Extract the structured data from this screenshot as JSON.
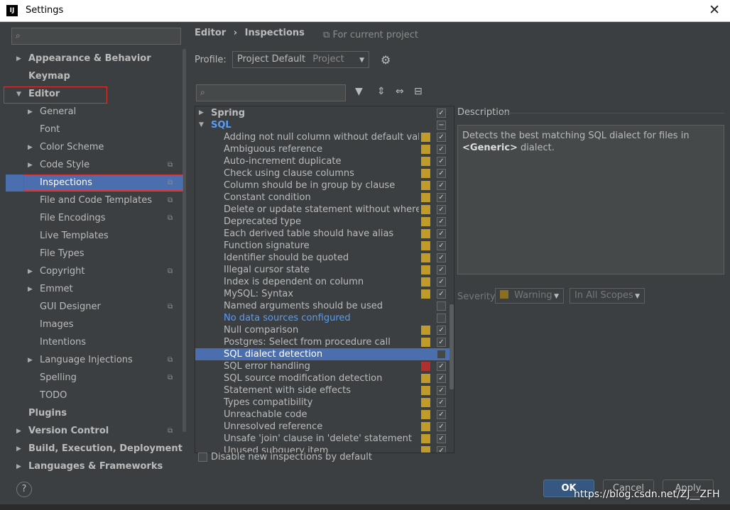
{
  "window": {
    "title": "Settings",
    "app_icon": "IJ",
    "close_symbol": "✕"
  },
  "sidebar": {
    "search_icon": "⌕",
    "items": [
      {
        "label": "Appearance & Behavior",
        "bold": true,
        "arrow": "right"
      },
      {
        "label": "Keymap",
        "bold": true
      },
      {
        "label": "Editor",
        "bold": true,
        "arrow": "down"
      },
      {
        "label": "General",
        "arrow": "right"
      },
      {
        "label": "Font"
      },
      {
        "label": "Color Scheme",
        "arrow": "right"
      },
      {
        "label": "Code Style",
        "arrow": "right",
        "project": true
      },
      {
        "label": "Inspections",
        "selected": true,
        "project": true
      },
      {
        "label": "File and Code Templates",
        "project": true
      },
      {
        "label": "File Encodings",
        "project": true
      },
      {
        "label": "Live Templates"
      },
      {
        "label": "File Types"
      },
      {
        "label": "Copyright",
        "arrow": "right",
        "project": true
      },
      {
        "label": "Emmet",
        "arrow": "right"
      },
      {
        "label": "GUI Designer",
        "project": true
      },
      {
        "label": "Images"
      },
      {
        "label": "Intentions"
      },
      {
        "label": "Language Injections",
        "arrow": "right",
        "project": true
      },
      {
        "label": "Spelling",
        "project": true
      },
      {
        "label": "TODO"
      },
      {
        "label": "Plugins",
        "bold": true
      },
      {
        "label": "Version Control",
        "bold": true,
        "arrow": "right",
        "project": true
      },
      {
        "label": "Build, Execution, Deployment",
        "bold": true,
        "arrow": "right"
      },
      {
        "label": "Languages & Frameworks",
        "bold": true,
        "arrow": "right"
      }
    ]
  },
  "breadcrumb": {
    "part1": "Editor",
    "sep": "›",
    "part2": "Inspections",
    "project_icon": "⧉",
    "for_project": "For current project"
  },
  "profile": {
    "label": "Profile:",
    "value": "Project Default",
    "scope": "Project",
    "chevron": "▼",
    "gear_icon": "⚙"
  },
  "toolbar": {
    "filter_icon": "▼",
    "expand_icon": "⇕",
    "collapse_icon": "⇔",
    "minus_icon": "⊟",
    "search_icon": "⌕"
  },
  "inspection_groups": [
    {
      "label": "Spring",
      "expanded": false,
      "checked": "check"
    },
    {
      "label": "SQL",
      "expanded": true,
      "checked": "partial"
    }
  ],
  "inspections": [
    {
      "label": "Adding not null column without default value",
      "sev": "warn",
      "checked": true
    },
    {
      "label": "Ambiguous reference",
      "sev": "warn",
      "checked": true
    },
    {
      "label": "Auto-increment duplicate",
      "sev": "warn",
      "checked": true
    },
    {
      "label": "Check using clause columns",
      "sev": "warn",
      "checked": true
    },
    {
      "label": "Column should be in group by clause",
      "sev": "warn",
      "checked": true
    },
    {
      "label": "Constant condition",
      "sev": "warn",
      "checked": true
    },
    {
      "label": "Delete or update statement without where clause",
      "sev": "warn",
      "checked": true
    },
    {
      "label": "Deprecated type",
      "sev": "warn",
      "checked": true
    },
    {
      "label": "Each derived table should have alias",
      "sev": "warn",
      "checked": true
    },
    {
      "label": "Function signature",
      "sev": "warn",
      "checked": true
    },
    {
      "label": "Identifier should be quoted",
      "sev": "warn",
      "checked": true
    },
    {
      "label": "Illegal cursor state",
      "sev": "warn",
      "checked": true
    },
    {
      "label": "Index is dependent on column",
      "sev": "warn",
      "checked": true
    },
    {
      "label": "MySQL: Syntax",
      "sev": "warn",
      "checked": true
    },
    {
      "label": "Named arguments should be used",
      "sev": "none",
      "checked": false
    },
    {
      "label": "No data sources configured",
      "sev": "none",
      "checked": false,
      "link": true
    },
    {
      "label": "Null comparison",
      "sev": "warn",
      "checked": true
    },
    {
      "label": "Postgres: Select from procedure call",
      "sev": "warn",
      "checked": true
    },
    {
      "label": "SQL dialect detection",
      "sev": "none",
      "checked": false,
      "selected": true
    },
    {
      "label": "SQL error handling",
      "sev": "err",
      "checked": true
    },
    {
      "label": "SQL source modification detection",
      "sev": "warn",
      "checked": true
    },
    {
      "label": "Statement with side effects",
      "sev": "warn",
      "checked": true
    },
    {
      "label": "Types compatibility",
      "sev": "warn",
      "checked": true
    },
    {
      "label": "Unreachable code",
      "sev": "warn",
      "checked": true
    },
    {
      "label": "Unresolved reference",
      "sev": "warn",
      "checked": true
    },
    {
      "label": "Unsafe 'join' clause in 'delete' statement",
      "sev": "warn",
      "checked": true
    },
    {
      "label": "Unused subquery item",
      "sev": "warn",
      "checked": true
    }
  ],
  "description": {
    "title": "Description",
    "text_before": "Detects the best matching SQL dialect for files in ",
    "text_strong": "<Generic>",
    "text_after": " dialect."
  },
  "severity": {
    "label": "Severity:",
    "value": "Warning",
    "scope": "In All Scopes",
    "chevron": "▼"
  },
  "bottom": {
    "disable_label": "Disable new inspections by default"
  },
  "buttons": {
    "help": "?",
    "ok": "OK",
    "cancel": "Cancel",
    "apply": "Apply"
  },
  "watermark": "https://blog.csdn.net/ZJ__ZFH",
  "colors": {
    "accent": "#4b6eaf",
    "warning": "#c19b2a",
    "error": "#b03030",
    "link": "#589df6",
    "highlight_box": "#e03030"
  }
}
